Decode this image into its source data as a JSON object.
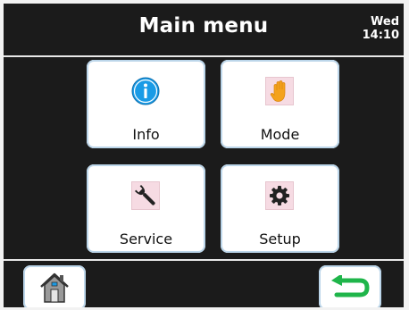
{
  "header": {
    "title": "Main menu",
    "day": "Wed",
    "time": "14:10"
  },
  "menu": {
    "info": {
      "label": "Info",
      "icon": "info-icon"
    },
    "mode": {
      "label": "Mode",
      "icon": "hand-icon"
    },
    "service": {
      "label": "Service",
      "icon": "wrench-icon"
    },
    "setup": {
      "label": "Setup",
      "icon": "gear-icon"
    }
  },
  "nav": {
    "home_icon": "home-icon",
    "back_icon": "back-arrow-icon"
  },
  "colors": {
    "screen_bg": "#1b1b1b",
    "tile_bg": "#ffffff",
    "tile_border": "#bcd6ea",
    "info_blue": "#1a9be6",
    "hand_orange": "#f4a21c",
    "icon_pink_bg": "#f6dbe3",
    "back_green": "#1fb54a"
  }
}
